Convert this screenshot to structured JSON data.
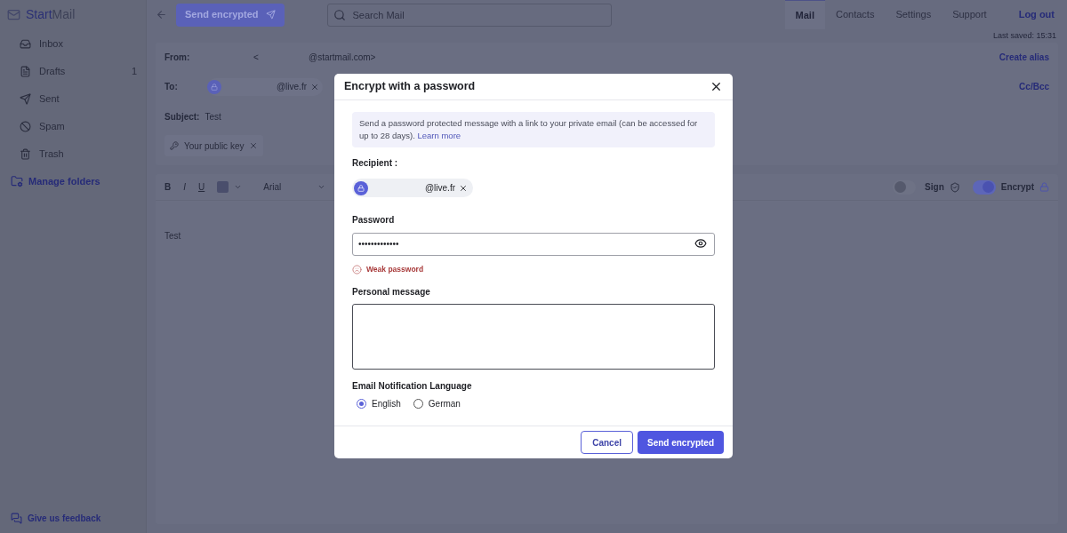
{
  "logo": {
    "prefix": "Start",
    "suffix": "Mail"
  },
  "toolbar": {
    "send_button": "Send encrypted",
    "search": {
      "placeholder": "Search Mail"
    }
  },
  "nav_tabs": [
    {
      "label": "Mail",
      "selected": true
    },
    {
      "label": "Contacts",
      "selected": false
    },
    {
      "label": "Settings",
      "selected": false
    },
    {
      "label": "Support",
      "selected": false
    }
  ],
  "logout": "Log out",
  "sidebar": {
    "items": [
      {
        "label": "Inbox"
      },
      {
        "label": "Drafts",
        "count": "1"
      },
      {
        "label": "Sent"
      },
      {
        "label": "Spam"
      },
      {
        "label": "Trash"
      }
    ],
    "manage": "Manage folders",
    "feedback": "Give us feedback"
  },
  "compose": {
    "last_saved": "Last saved: 15:31",
    "from_label": "From:",
    "from_bracket": "<",
    "from_value": "@startmail.com>",
    "create_alias": "Create alias",
    "to_label": "To:",
    "to_chip": "@live.fr",
    "cc_bcc": "Cc/Bcc",
    "subject_label": "Subject:",
    "subject_value": "Test",
    "key_chip": "Your public key",
    "format": {
      "bold": "B",
      "italic": "I",
      "underline": "U",
      "font": "Arial"
    },
    "sign": {
      "label": "Sign",
      "on": false
    },
    "encrypt": {
      "label": "Encrypt",
      "on": true
    },
    "body": "Test"
  },
  "dialog": {
    "title": "Encrypt with a password",
    "info": "Send a password protected message with a link to your private email (can be accessed for up to 28 days).",
    "learn_more": "Learn more",
    "recipient_label": "Recipient :",
    "recipient_chip": "@live.fr",
    "password_label": "Password",
    "password_value": "•••••••••••••",
    "strength": "Weak password",
    "message_label": "Personal message",
    "language_label": "Email Notification Language",
    "languages": [
      {
        "label": "English",
        "selected": true
      },
      {
        "label": "German",
        "selected": false
      }
    ],
    "cancel": "Cancel",
    "send": "Send encrypted"
  }
}
